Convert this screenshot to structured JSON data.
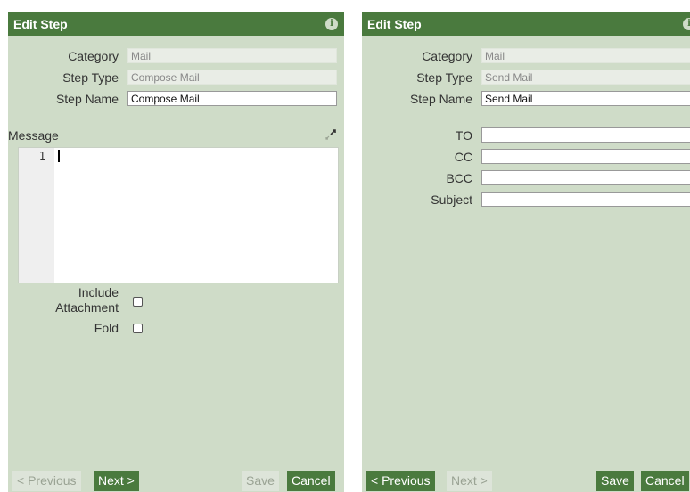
{
  "left_dialog": {
    "title": "Edit Step",
    "fields": {
      "category_label": "Category",
      "category_value": "Mail",
      "step_type_label": "Step Type",
      "step_type_value": "Compose Mail",
      "step_name_label": "Step Name",
      "step_name_value": "Compose Mail"
    },
    "message_label": "Message",
    "editor": {
      "line_numbers": [
        "1"
      ]
    },
    "include_attachment_label_line1": "Include",
    "include_attachment_label_line2": "Attachment",
    "fold_label": "Fold",
    "buttons": {
      "previous": "< Previous",
      "next": "Next >",
      "save": "Save",
      "cancel": "Cancel"
    }
  },
  "right_dialog": {
    "title": "Edit Step",
    "fields": {
      "category_label": "Category",
      "category_value": "Mail",
      "step_type_label": "Step Type",
      "step_type_value": "Send Mail",
      "step_name_label": "Step Name",
      "step_name_value": "Send Mail",
      "to_label": "TO",
      "cc_label": "CC",
      "bcc_label": "BCC",
      "subject_label": "Subject"
    },
    "buttons": {
      "previous": "< Previous",
      "next": "Next >",
      "save": "Save",
      "cancel": "Cancel"
    }
  },
  "colors": {
    "header_green": "#4a7a3e",
    "panel_bg": "#cfdcc8"
  },
  "icons": [
    "info-icon",
    "expand-icon"
  ]
}
